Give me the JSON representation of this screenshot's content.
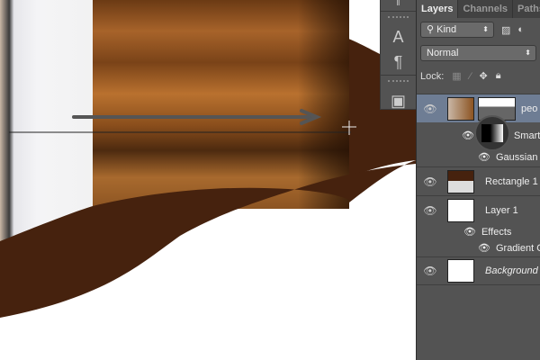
{
  "panel": {
    "tabs": [
      {
        "label": "Layers"
      },
      {
        "label": "Channels"
      },
      {
        "label": "Paths"
      }
    ],
    "filter": {
      "value": "Kind"
    },
    "blend_mode": {
      "value": "Normal"
    },
    "lock_label": "Lock:",
    "layers": [
      {
        "name": "peo",
        "sub": [
          {
            "name": "Smart F"
          },
          {
            "name": "Gaussian Blu"
          }
        ]
      },
      {
        "name": "Rectangle 1"
      },
      {
        "name": "Layer 1",
        "effects_label": "Effects",
        "sub": [
          {
            "name": "Gradient Ov"
          }
        ]
      },
      {
        "name": "Background"
      }
    ]
  },
  "colors": {
    "brown": "#46220e",
    "panel": "#535353",
    "selected": "#6e7d94"
  }
}
